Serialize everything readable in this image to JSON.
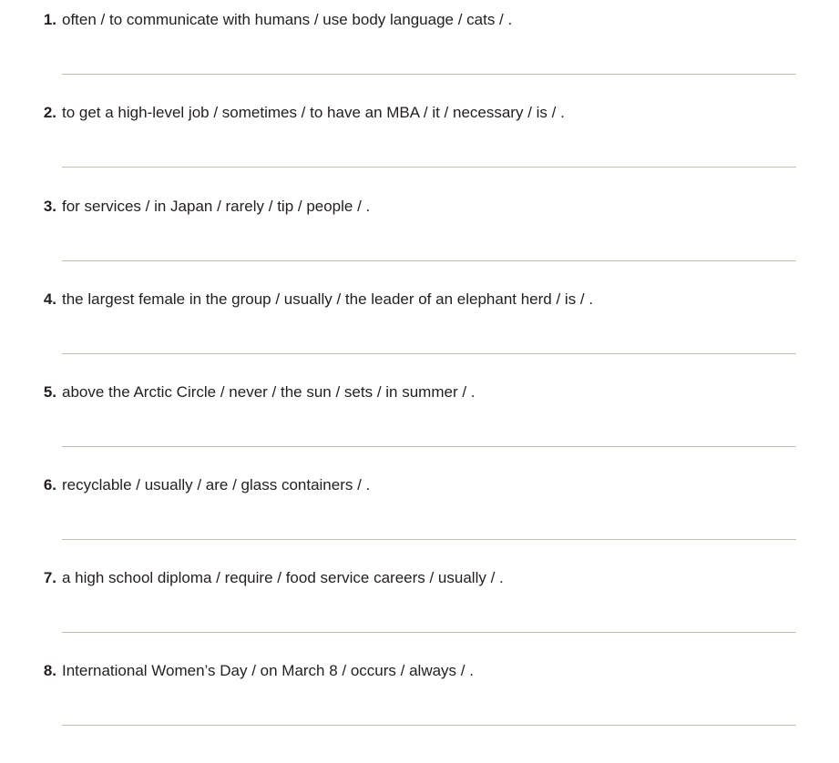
{
  "items": [
    {
      "number": "1.",
      "prompt": "often / to communicate with humans / use body language / cats / ."
    },
    {
      "number": "2.",
      "prompt": "to get a high-level job / sometimes / to have an MBA / it / necessary / is / ."
    },
    {
      "number": "3.",
      "prompt": "for services / in Japan / rarely / tip / people / ."
    },
    {
      "number": "4.",
      "prompt": "the largest female in the group / usually / the leader of an elephant herd / is / ."
    },
    {
      "number": "5.",
      "prompt": "above the Arctic Circle / never / the sun / sets / in summer / ."
    },
    {
      "number": "6.",
      "prompt": "recyclable / usually / are / glass containers / ."
    },
    {
      "number": "7.",
      "prompt": "a high school diploma / require / food service careers / usually / ."
    },
    {
      "number": "8.",
      "prompt": "International Women’s Day / on March 8 / occurs / always / ."
    }
  ],
  "colors": {
    "text": "#231f20",
    "answer_line": "#b7c4b2"
  }
}
